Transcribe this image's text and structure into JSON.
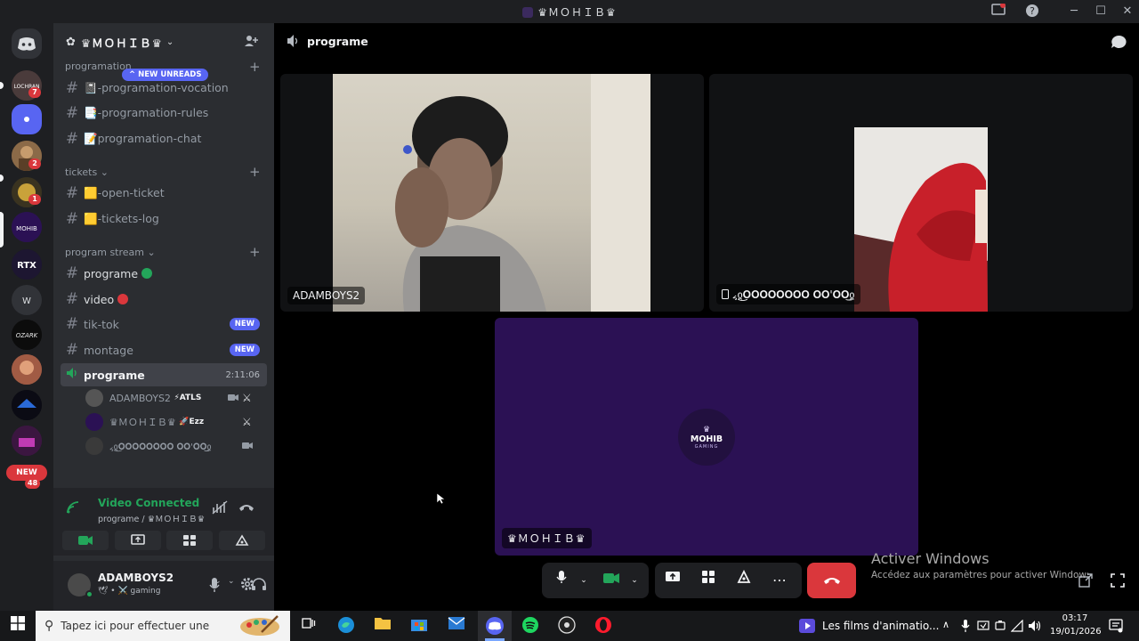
{
  "window": {
    "title": "♛ＭＯＨＩＢ♛"
  },
  "server": {
    "name": "♛ＭＯＨＩＢ♛"
  },
  "sidebar": {
    "unreads_pill": "NEW UNREADS",
    "categories": [
      {
        "name": "programation"
      },
      {
        "name": "tickets"
      },
      {
        "name": "program stream"
      }
    ],
    "channels": [
      {
        "label": "📓-programation-vocation"
      },
      {
        "label": "📑-programation-rules"
      },
      {
        "label": "📝programation-chat"
      },
      {
        "label": "🟨-open-ticket"
      },
      {
        "label": "🟨-tickets-log"
      },
      {
        "label": "programe"
      },
      {
        "label": "video"
      },
      {
        "label": "tik-tok",
        "badge": "NEW"
      },
      {
        "label": "montage",
        "badge": "NEW"
      }
    ],
    "voice_channel": {
      "label": "programe",
      "timer": "2:11:06"
    },
    "voice_users": [
      {
        "name": "ADAMBOYS2",
        "tag": "⚡ATLS"
      },
      {
        "name": "♛ＭＯＨＩＢ♛",
        "tag": "🚀Ezz"
      },
      {
        "name": "៹ჲ͜𝐎𝐎𝐎𝐎𝐎𝐎𝐎𝐎 𝐎𝐎'𝐎𝐎͜ჲ"
      }
    ]
  },
  "rail": {
    "servers": [
      {
        "badge": "7"
      },
      {
        "badge": ""
      },
      {
        "badge": "2"
      },
      {
        "badge": "1"
      },
      {
        "label": "RTX"
      },
      {
        "label": "W"
      },
      {
        "label": "OZARK"
      }
    ],
    "new_pill": "NEW",
    "new_count": "48"
  },
  "voice_panel": {
    "status": "Video Connected",
    "subtitle": "programe / ♛ＭＯＨＩＢ♛"
  },
  "user_panel": {
    "name": "ADAMBOYS2",
    "status": "🕊 • ⚔️ gaming"
  },
  "header": {
    "channel": "programe"
  },
  "tiles": [
    {
      "name": "ADAMBOYS2"
    },
    {
      "name": "៹ჲ͜𝐎𝐎𝐎𝐎𝐎𝐎𝐎𝐎 𝐎𝐎'𝐎𝐎͜ჲ"
    },
    {
      "name": "♛ＭＯＨＩＢ♛",
      "logo_text": "MOHIB",
      "logo_sub": "GAMING"
    }
  ],
  "watermark": {
    "title": "Activer Windows",
    "subtitle": "Accédez aux paramètres pour activer Windows."
  },
  "taskbar": {
    "search_placeholder": "Tapez ici pour effectuer une",
    "media_title": "Les films d'animatio...",
    "time": "03:17",
    "date": "19/01/2026"
  },
  "colors": {
    "accent": "#5865f2",
    "green": "#23a55a",
    "red": "#da373c",
    "tile_purple": "#2b1154"
  }
}
